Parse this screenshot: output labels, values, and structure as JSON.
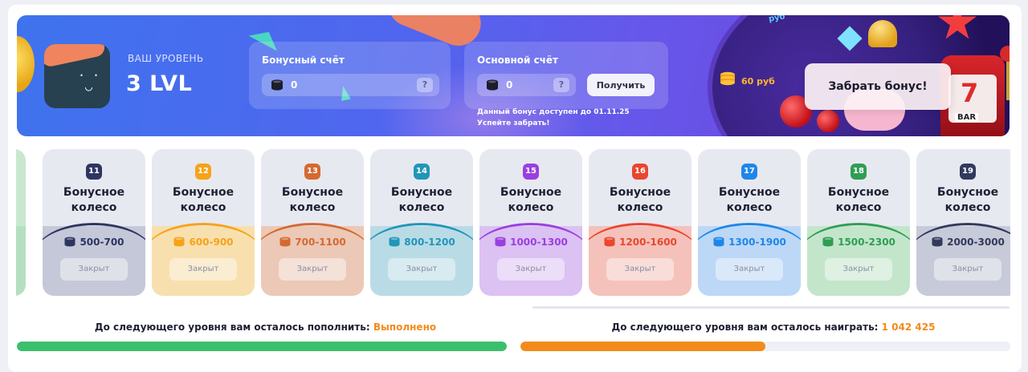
{
  "level": {
    "label": "ВАШ УРОВЕНЬ",
    "value": "3 LVL"
  },
  "bonus_account": {
    "title": "Бонусный счёт",
    "value": "0",
    "help": "?"
  },
  "main_account": {
    "title": "Основной счёт",
    "value": "0",
    "help": "?",
    "button": "Получить"
  },
  "notes": {
    "line1": "Данный бонус доступен до 01.11.25",
    "line2": "Успейте забрать!"
  },
  "promo": {
    "wheel_text": "руб",
    "prize": "60 руб",
    "claim_button": "Забрать бонус!",
    "slot_bar": "BAR",
    "slot_seven": "7"
  },
  "wheels": [
    {
      "level": "11",
      "name1": "Бонусное",
      "name2": "колесо",
      "range": "500-700",
      "status": "Закрыт",
      "color": "#2d3561",
      "bg": "#c5c8d8"
    },
    {
      "level": "12",
      "name1": "Бонусное",
      "name2": "колесо",
      "range": "600-900",
      "status": "Закрыт",
      "color": "#f6a318",
      "bg": "#f8dfae"
    },
    {
      "level": "13",
      "name1": "Бонусное",
      "name2": "колесо",
      "range": "700-1100",
      "status": "Закрыт",
      "color": "#d46a32",
      "bg": "#ecc8b6"
    },
    {
      "level": "14",
      "name1": "Бонусное",
      "name2": "колесо",
      "range": "800-1200",
      "status": "Закрыт",
      "color": "#2196b8",
      "bg": "#b9dbe6"
    },
    {
      "level": "15",
      "name1": "Бонусное",
      "name2": "колесо",
      "range": "1000-1300",
      "status": "Закрыт",
      "color": "#9b3fe0",
      "bg": "#dcc1f3"
    },
    {
      "level": "16",
      "name1": "Бонусное",
      "name2": "колесо",
      "range": "1200-1600",
      "status": "Закрыт",
      "color": "#ea4630",
      "bg": "#f4c2bb"
    },
    {
      "level": "17",
      "name1": "Бонусное",
      "name2": "колесо",
      "range": "1300-1900",
      "status": "Закрыт",
      "color": "#1f86e8",
      "bg": "#bcd8f6"
    },
    {
      "level": "18",
      "name1": "Бонусное",
      "name2": "колесо",
      "range": "1500-2300",
      "status": "Закрыт",
      "color": "#2f9e52",
      "bg": "#c3e6cb"
    },
    {
      "level": "19",
      "name1": "Бонусное",
      "name2": "колесо",
      "range": "2000-3000",
      "status": "Закрыт",
      "color": "#323a5c",
      "bg": "#c7cad8"
    }
  ],
  "progress": {
    "deposit": {
      "label": "До следующего уровня вам осталось пополнить:",
      "value": "Выполнено",
      "fraction": 1.0,
      "color": "#3bbf6c"
    },
    "wager": {
      "label": "До следующего уровня вам осталось наиграть:",
      "value": "1 042 425",
      "fraction": 0.5,
      "color": "#f28b1c"
    }
  }
}
